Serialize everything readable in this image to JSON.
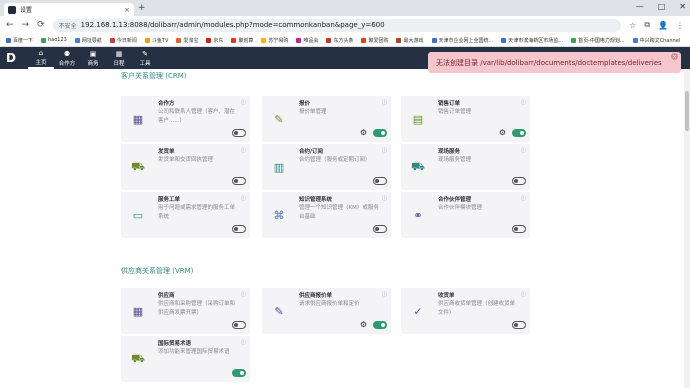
{
  "browser": {
    "tab_title": "设置",
    "tab_close": "×",
    "new_tab": "+",
    "win_min": "—",
    "win_max": "□",
    "win_close": "✕",
    "nav_back": "←",
    "nav_forward": "→",
    "nav_reload": "⟳",
    "secure_label": "不安全",
    "url": "192.168.1.13:8088/dolibarr/admin/modules.php?mode=commonkanban&page_y=600",
    "bookmark_star": "☆",
    "extensions_icon": "⧉",
    "profile_icon": "👤",
    "menu_icon": "⋮"
  },
  "bookmarks": [
    {
      "label": "百度一下",
      "color": "#3b6fd8"
    },
    {
      "label": "hao123",
      "color": "#3aa15a"
    },
    {
      "label": "网址导航",
      "color": "#4a7bd0"
    },
    {
      "label": "今日新闻",
      "color": "#d23b3b"
    },
    {
      "label": "斗鱼TV",
      "color": "#f39a1e"
    },
    {
      "label": "爱淘宝",
      "color": "#f05a22"
    },
    {
      "label": "京东",
      "color": "#d81e06"
    },
    {
      "label": "聚划算",
      "color": "#e6322a"
    },
    {
      "label": "苏宁易购",
      "color": "#f5b400"
    },
    {
      "label": "唯品会",
      "color": "#c4208d"
    },
    {
      "label": "东方头条",
      "color": "#d42b2b"
    },
    {
      "label": "聚爱团购",
      "color": "#e0401b"
    },
    {
      "label": "最大游戏",
      "color": "#c63a1a"
    },
    {
      "label": "天津市企业网上全国统...",
      "color": "#3b6fd8"
    },
    {
      "label": "天津市滨海新区市场监...",
      "color": "#3b6fd8"
    },
    {
      "label": "首页-中国电力规划...",
      "color": "#3aa15a"
    },
    {
      "label": "中兴跨文Channel",
      "color": "#4a7bd0"
    }
  ],
  "app": {
    "logo": "D",
    "menu": [
      {
        "icon": "⌂",
        "label": "主页",
        "active": true
      },
      {
        "icon": "⚉",
        "label": "合作方",
        "active": false
      },
      {
        "icon": "▣",
        "label": "商务",
        "active": false
      },
      {
        "icon": "▦",
        "label": "日程",
        "active": false
      },
      {
        "icon": "✎",
        "label": "工具",
        "active": false
      }
    ]
  },
  "toast": {
    "message": "无法创建目录 /var/lib/dolibarr/documents/doctemplates/deliveries",
    "close": "×"
  },
  "sections": {
    "crm_title": "客户关系管理 (CRM)",
    "srm_title": "供应商关系管理 (VRM)"
  },
  "icons": {
    "info": "ⓘ",
    "gear": "⚙"
  },
  "cards": [
    {
      "title": "合作方",
      "desc": "公司和联系人管理（客户、潜在客户......）",
      "icon": "▦",
      "icon_color": "#5a4a96",
      "on": false,
      "gear": false
    },
    {
      "title": "报价",
      "desc": "报价单管理",
      "icon": "✎",
      "icon_color": "#7a8a20",
      "on": true,
      "gear": true
    },
    {
      "title": "销售订单",
      "desc": "销售订单管理",
      "icon": "▤",
      "icon_color": "#6d8e2a",
      "on": true,
      "gear": true
    },
    {
      "title": "发货单",
      "desc": "发货单和交货回执管理",
      "icon": "⛟",
      "icon_color": "#6d8e2a",
      "on": false,
      "gear": false
    },
    {
      "title": "合约/订阅",
      "desc": "合约管理（服务或定期订阅）",
      "icon": "▥",
      "icon_color": "#2e8a7e",
      "on": false,
      "gear": false
    },
    {
      "title": "现场服务",
      "desc": "现场服务管理",
      "icon": "⛟",
      "icon_color": "#2e8a7e",
      "on": false,
      "gear": false
    },
    {
      "title": "服务工单",
      "desc": "用于问题或需求管理的服务工单系统",
      "icon": "▭",
      "icon_color": "#2e9a6f",
      "on": false,
      "gear": false
    },
    {
      "title": "知识管理系统",
      "desc": "管理一个知识管理（KM）或服务台基础",
      "icon": "⌘",
      "icon_color": "#4a7bd0",
      "on": false,
      "gear": false
    },
    {
      "title": "合作伙伴管理",
      "desc": "合作伙伴模块管理",
      "icon": "⚭",
      "icon_color": "#5a4a96",
      "on": false,
      "gear": false
    },
    {
      "title": "供应商",
      "desc": "供应商和采购管理（采购订单和供应商发票开票）",
      "icon": "▦",
      "icon_color": "#5a4a96",
      "on": false,
      "gear": false
    },
    {
      "title": "供应商报价单",
      "desc": "请求供应商报价单和定价",
      "icon": "✎",
      "icon_color": "#5a4a96",
      "on": true,
      "gear": true
    },
    {
      "title": "收货单",
      "desc": "供应商收货单管理（创建收货单文件）",
      "icon": "✓",
      "icon_color": "#5a4a96",
      "on": false,
      "gear": false
    },
    {
      "title": "国际贸易术语",
      "desc": "添加功能来管理国际贸易术语",
      "icon": "⛟",
      "icon_color": "#6d8e2a",
      "on": true,
      "gear": false
    }
  ]
}
